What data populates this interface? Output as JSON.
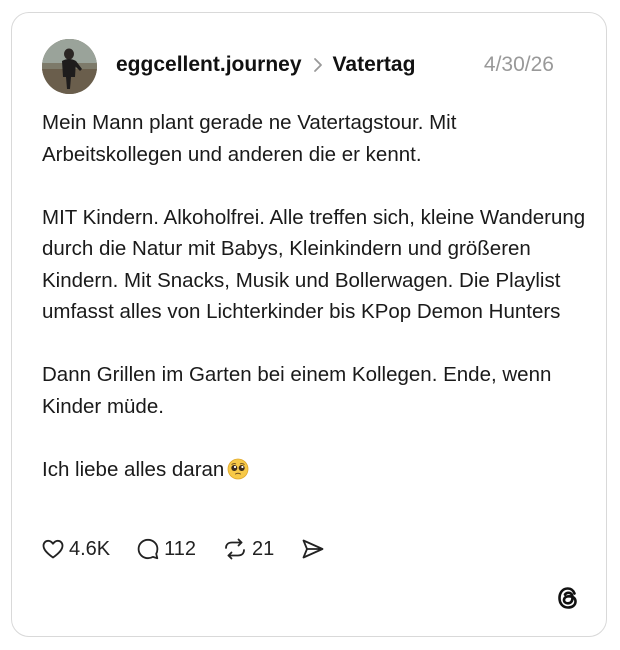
{
  "post": {
    "username": "eggcellent.journey",
    "topic": "Vatertag",
    "date": "4/30/26",
    "paragraphs": [
      "Mein Mann plant gerade ne Vatertagstour. Mit Arbeitskollegen und anderen die er kennt.",
      "MIT Kindern. Alkoholfrei. Alle treffen sich, kleine Wanderung durch die Natur mit Babys, Kleinkindern und größeren Kindern. Mit Snacks, Musik und Bollerwagen. Die Playlist umfasst alles von Lichterkinder bis KPop Demon Hunters",
      "Dann Grillen im Garten bei einem Kollegen. Ende, wenn Kinder müde.",
      "Ich liebe alles daran"
    ],
    "emoji": "pleading-face-emoji"
  },
  "actions": {
    "likes": "4.6K",
    "replies": "112",
    "reposts": "21"
  },
  "icons": {
    "like": "heart-icon",
    "reply": "comment-icon",
    "repost": "repost-icon",
    "share": "send-icon",
    "brand": "threads-logo-icon"
  }
}
